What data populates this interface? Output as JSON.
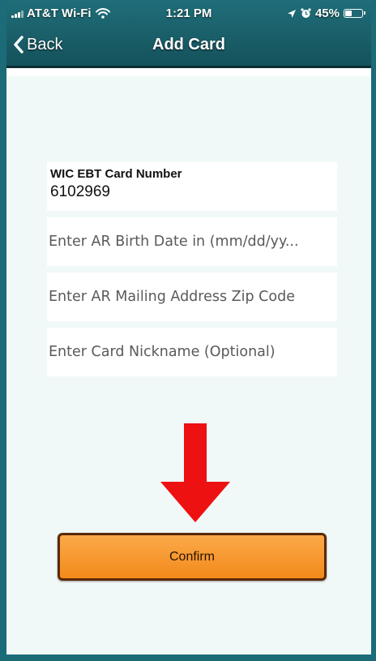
{
  "status_bar": {
    "carrier": "AT&T Wi-Fi",
    "time": "1:21 PM",
    "battery": "45%",
    "battery_level": 0.45,
    "icons": [
      "signal-icon",
      "wifi-icon",
      "location-icon",
      "alarm-icon",
      "battery-icon"
    ]
  },
  "nav": {
    "back_label": "Back",
    "title": "Add Card"
  },
  "form": {
    "card_number": {
      "label": "WIC EBT Card Number",
      "value": "6102969"
    },
    "birth_date": {
      "placeholder": "Enter AR Birth Date in (mm/dd/yy..."
    },
    "zip_code": {
      "placeholder": "Enter AR Mailing Address Zip Code"
    },
    "nickname": {
      "placeholder": "Enter Card Nickname (Optional)"
    }
  },
  "confirm_label": "Confirm",
  "colors": {
    "nav_bar": "#1b6b78",
    "background": "#f1f8f8",
    "confirm_button": "#f7931e",
    "arrow": "#ee1111"
  }
}
